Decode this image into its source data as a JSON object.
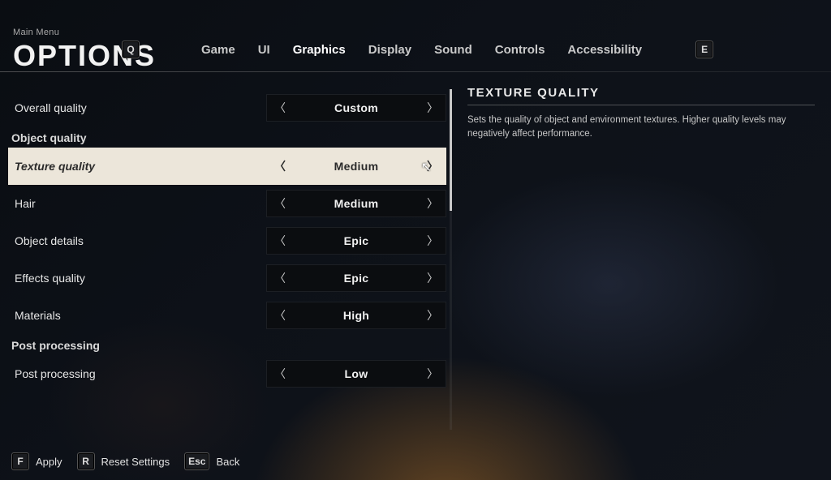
{
  "header": {
    "breadcrumb": "Main Menu",
    "title": "OPTIONS",
    "prev_key": "Q",
    "next_key": "E",
    "tabs": [
      "Game",
      "UI",
      "Graphics",
      "Display",
      "Sound",
      "Controls",
      "Accessibility"
    ],
    "active_tab": "Graphics"
  },
  "settings": {
    "overall_quality": {
      "label": "Overall quality",
      "value": "Custom"
    },
    "section_object": "Object quality",
    "texture_quality": {
      "label": "Texture quality",
      "value": "Medium"
    },
    "hair": {
      "label": "Hair",
      "value": "Medium"
    },
    "object_details": {
      "label": "Object details",
      "value": "Epic"
    },
    "effects_quality": {
      "label": "Effects quality",
      "value": "Epic"
    },
    "materials": {
      "label": "Materials",
      "value": "High"
    },
    "section_post": "Post processing",
    "post_processing": {
      "label": "Post processing",
      "value": "Low"
    }
  },
  "description": {
    "title": "TEXTURE QUALITY",
    "body": "Sets the quality of object and environment textures. Higher quality levels may negatively affect performance."
  },
  "footer": {
    "apply": {
      "key": "F",
      "label": "Apply"
    },
    "reset": {
      "key": "R",
      "label": "Reset Settings"
    },
    "back": {
      "key": "Esc",
      "label": "Back"
    }
  }
}
